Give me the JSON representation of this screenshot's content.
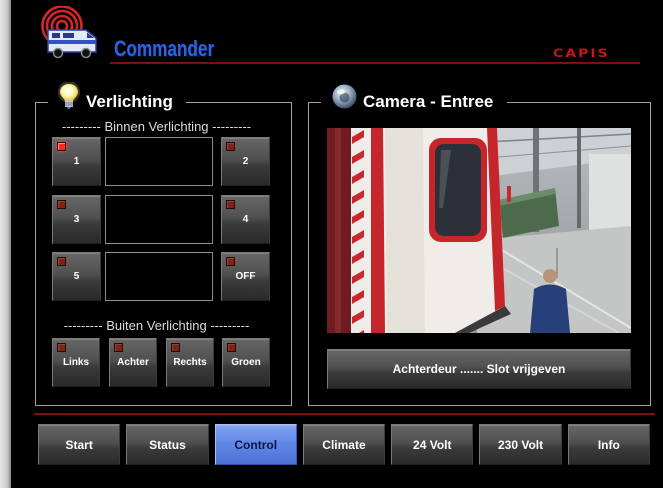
{
  "header": {
    "app_title": "Commander",
    "brand_logo_text": "CAPIS",
    "logo_icon": "rv-truck-radar-icon"
  },
  "lighting": {
    "title": "Verlichting",
    "icon": "light-bulb-icon",
    "indoor": {
      "heading": "--------- Binnen Verlichting ---------",
      "buttons": [
        {
          "label": "1",
          "led_on": true
        },
        {
          "label": "2",
          "led_on": false
        },
        {
          "label": "3",
          "led_on": false
        },
        {
          "label": "4",
          "led_on": false
        },
        {
          "label": "5",
          "led_on": false
        },
        {
          "label": "OFF",
          "led_on": false
        }
      ]
    },
    "outdoor": {
      "heading": "--------- Buiten Verlichting ---------",
      "buttons": [
        {
          "label": "Links",
          "led_on": false
        },
        {
          "label": "Achter",
          "led_on": false
        },
        {
          "label": "Rechts",
          "led_on": false
        },
        {
          "label": "Groen",
          "led_on": false
        }
      ]
    }
  },
  "camera": {
    "title": "Camera - Entree",
    "icon": "camera-icon",
    "unlock_button_label": "Achterdeur ....... Slot vrijgeven"
  },
  "nav": {
    "active_item": "Control",
    "items": [
      {
        "label": "Start"
      },
      {
        "label": "Status"
      },
      {
        "label": "Control"
      },
      {
        "label": "Climate"
      },
      {
        "label": "24 Volt"
      },
      {
        "label": "230 Volt"
      },
      {
        "label": "Info"
      }
    ]
  },
  "colors": {
    "title_blue": "#2f62e0",
    "brand_red": "#c0181c",
    "accent_blue": "#5b82e6",
    "led_on": "#ff2a18",
    "led_off": "#7e2416",
    "separator_red": "#7c0f10"
  }
}
